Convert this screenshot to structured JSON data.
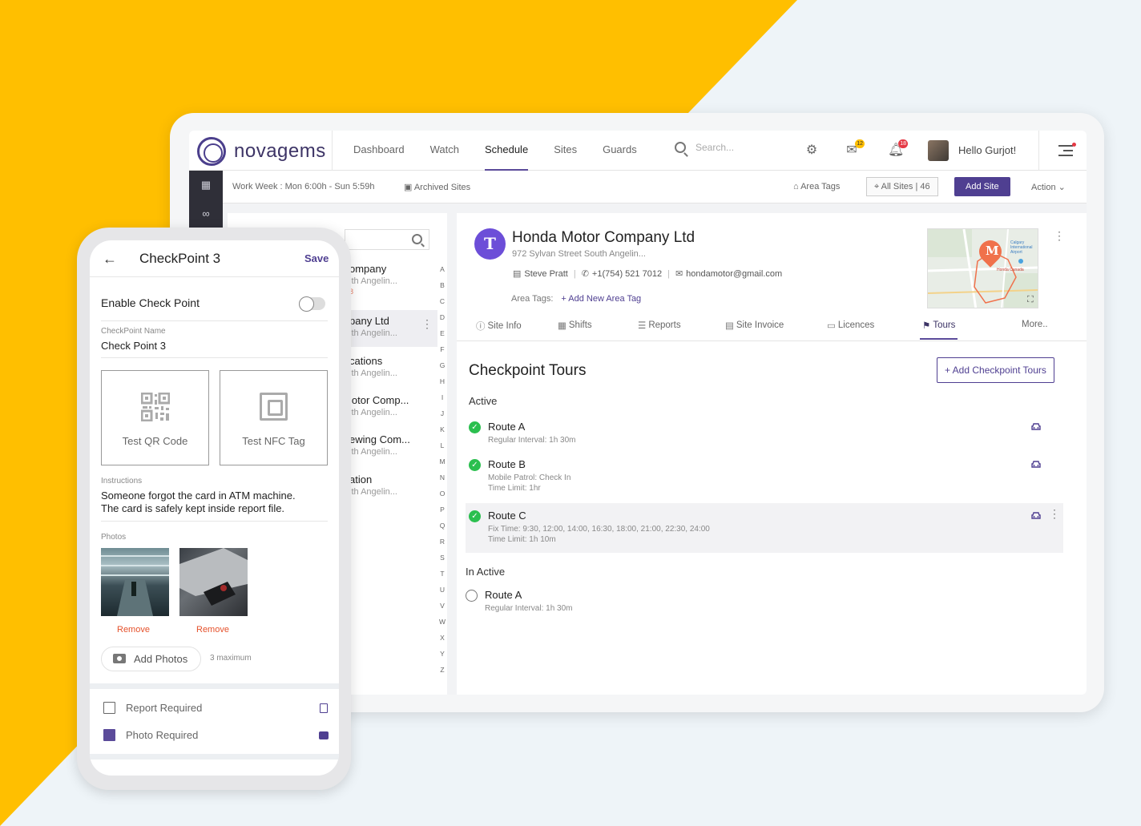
{
  "brand": {
    "name": "novagems",
    "accent": "#4f3f91",
    "background_accent": "#ffbf00"
  },
  "nav": {
    "items": [
      "Dashboard",
      "Watch",
      "Schedule",
      "Sites",
      "Guards"
    ],
    "active": "Schedule",
    "search_placeholder": "Search...",
    "mail_badge": "12",
    "bell_badge": "18",
    "greeting": "Hello Gurjot!"
  },
  "subbar": {
    "work_week": "Work Week : Mon 6:00h - Sun 5:59h",
    "archived": "Archived Sites",
    "area_tags": "Area Tags",
    "all_sites": "All Sites | 46",
    "add_site": "Add Site",
    "action": "Action"
  },
  "site_list": {
    "items": [
      {
        "name": "ompany",
        "addr": "ith Angelin...",
        "extra": "8"
      },
      {
        "name": "pany Ltd",
        "addr": "ith Angelin...",
        "extra": ""
      },
      {
        "name": "cations",
        "addr": "ith Angelin...",
        "extra": ""
      },
      {
        "name": "lotor Comp...",
        "addr": "ith Angelin...",
        "extra": ""
      },
      {
        "name": "ewing Com...",
        "addr": "ith Angelin...",
        "extra": ""
      },
      {
        "name": "ation",
        "addr": "ith Angelin...",
        "extra": ""
      }
    ],
    "alphabet": [
      "A",
      "B",
      "C",
      "D",
      "E",
      "F",
      "G",
      "H",
      "I",
      "J",
      "K",
      "L",
      "M",
      "N",
      "O",
      "P",
      "Q",
      "R",
      "S",
      "T",
      "U",
      "V",
      "W",
      "X",
      "Y",
      "Z"
    ]
  },
  "site": {
    "initial": "T",
    "name": "Honda Motor Company Ltd",
    "address": "972 Sylvan Street South Angelin...",
    "contact_name": "Steve Pratt",
    "phone": "+1(754) 521 7012",
    "email": "hondamotor@gmail.com",
    "area_tags_label": "Area Tags:",
    "add_area_tag": "+ Add New Area Tag",
    "map_pin": "M",
    "map_label_airport": "Calgary International Airport",
    "map_label_honda": "Honda Canada"
  },
  "tabs": {
    "items": [
      "Site Info",
      "Shifts",
      "Reports",
      "Site Invoice",
      "Licences",
      "Tours",
      "More.."
    ],
    "active": "Tours"
  },
  "tours": {
    "title": "Checkpoint Tours",
    "add_button": "+ Add Checkpoint Tours",
    "active_label": "Active",
    "inactive_label": "In Active",
    "active": [
      {
        "name": "Route A",
        "line1": "Regular Interval: 1h 30m",
        "line2": ""
      },
      {
        "name": "Route B",
        "line1": "Mobile Patrol: Check In",
        "line2": "Time Limit: 1hr"
      },
      {
        "name": "Route C",
        "line1": "Fix Time: 9:30, 12:00, 14:00, 16:30, 18:00, 21:00, 22:30, 24:00",
        "line2": "Time Limit: 1h 10m"
      }
    ],
    "inactive": [
      {
        "name": "Route A",
        "line1": "Regular Interval: 1h 30m"
      }
    ]
  },
  "phone": {
    "title": "CheckPoint 3",
    "save": "Save",
    "enable_label": "Enable Check Point",
    "enabled": false,
    "name_label": "CheckPoint Name",
    "name_value": "Check Point 3",
    "test_qr": "Test QR Code",
    "test_nfc": "Test NFC Tag",
    "instructions_label": "Instructions",
    "instructions_line1": "Someone forgot the card in ATM machine.",
    "instructions_line2": "The card is safely kept inside report file.",
    "photos_label": "Photos",
    "remove": "Remove",
    "add_photos": "Add Photos",
    "max_note": "3 maximum",
    "report_required": "Report Required",
    "report_checked": false,
    "photo_required": "Photo Required",
    "photo_checked": true
  }
}
